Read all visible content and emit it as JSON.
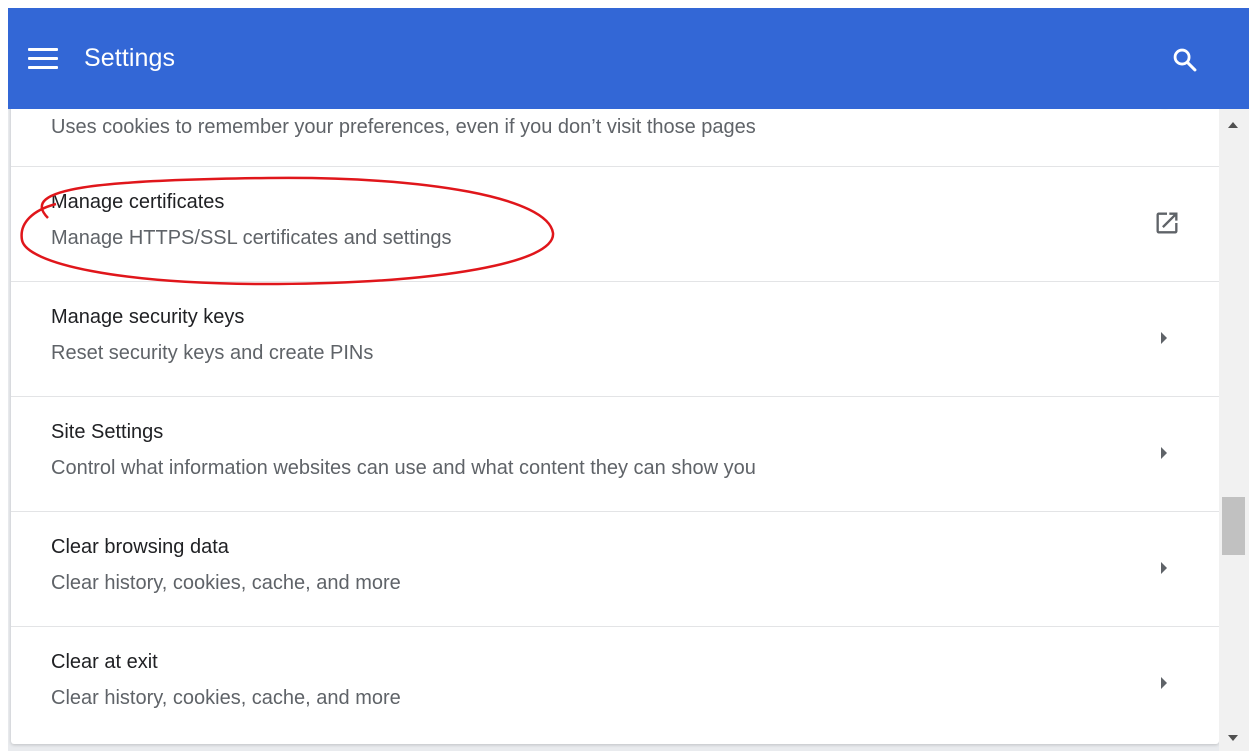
{
  "header": {
    "title": "Settings",
    "menu_icon": "hamburger-menu-icon",
    "search_icon": "search-icon",
    "background_color": "#3367d6"
  },
  "partial_item": {
    "subtitle": "Uses cookies to remember your preferences, even if you don’t visit those pages",
    "toggle_state": "on"
  },
  "items": [
    {
      "title": "Manage certificates",
      "subtitle": "Manage HTTPS/SSL certificates and settings",
      "icon": "open-in-new-icon",
      "highlighted": true
    },
    {
      "title": "Manage security keys",
      "subtitle": "Reset security keys and create PINs",
      "icon": "chevron-right-icon"
    },
    {
      "title": "Site Settings",
      "subtitle": "Control what information websites can use and what content they can show you",
      "icon": "chevron-right-icon"
    },
    {
      "title": "Clear browsing data",
      "subtitle": "Clear history, cookies, cache, and more",
      "icon": "chevron-right-icon"
    },
    {
      "title": "Clear at exit",
      "subtitle": "Clear history, cookies, cache, and more",
      "icon": "chevron-right-icon"
    }
  ],
  "annotation": {
    "shape": "ellipse",
    "color": "#e0161b",
    "target": "Manage certificates"
  }
}
